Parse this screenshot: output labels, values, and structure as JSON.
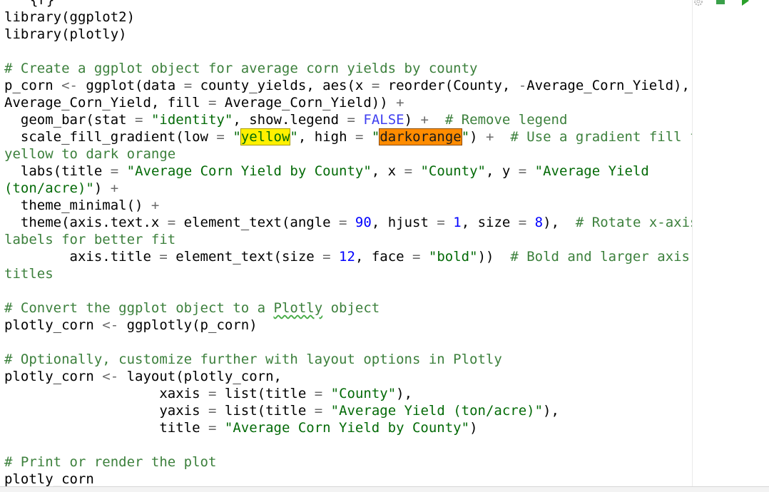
{
  "editor": {
    "lines": {
      "l0": "{r}",
      "l1": "library(ggplot2)",
      "l2": "library(plotly)",
      "l4": "# Create a ggplot object for average corn yields by county",
      "l5": {
        "a": "p_corn ",
        "b": "<-",
        "c": " ggplot(data ",
        "d": "=",
        "e": " county_yields, aes(x ",
        "f": "=",
        "g": " reorder(County, ",
        "h": "-",
        "i": "Average_Corn_Yield), y ",
        "j": "="
      },
      "l6": {
        "a": "Average_Corn_Yield, fill ",
        "b": "=",
        "c": " Average_Corn_Yield)) ",
        "d": "+"
      },
      "l7": {
        "a": "  geom_bar(stat ",
        "b": "=",
        "c": " ",
        "d": "\"identity\"",
        "e": ", show.legend ",
        "f": "=",
        "g": " ",
        "h": "FALSE",
        "i": ") ",
        "j": "+",
        "k": "  ",
        "l": "# Remove legend"
      },
      "l8": {
        "a": "  scale_fill_gradient(low ",
        "b": "=",
        "c": " ",
        "d": "\"",
        "e": "yellow",
        "f": "\"",
        "g": ", high ",
        "h": "=",
        "i": " ",
        "j": "\"",
        "k": "darkorange",
        "l": "\"",
        "m": ") ",
        "n": "+",
        "o": "  ",
        "p": "# Use a gradient fill from"
      },
      "l9": "yellow to dark orange",
      "l10": {
        "a": "  labs(title ",
        "b": "=",
        "c": " ",
        "d": "\"Average Corn Yield by County\"",
        "e": ", x ",
        "f": "=",
        "g": " ",
        "h": "\"County\"",
        "i": ", y ",
        "j": "=",
        "k": " ",
        "l": "\"Average Yield"
      },
      "l11": {
        "a": "(ton/acre)\"",
        "b": ") ",
        "c": "+"
      },
      "l12": {
        "a": "  theme_minimal() ",
        "b": "+"
      },
      "l13": {
        "a": "  theme(axis.text.x ",
        "b": "=",
        "c": " element_text(angle ",
        "d": "=",
        "e": " ",
        "f": "90",
        "g": ", hjust ",
        "h": "=",
        "i": " ",
        "j": "1",
        "k": ", size ",
        "l": "=",
        "m": " ",
        "n": "8",
        "o": "),  ",
        "p": "# Rotate x-axis"
      },
      "l14": "labels for better fit",
      "l15": {
        "a": "        axis.title ",
        "b": "=",
        "c": " element_text(size ",
        "d": "=",
        "e": " ",
        "f": "12",
        "g": ", face ",
        "h": "=",
        "i": " ",
        "j": "\"bold\"",
        "k": "))  ",
        "l": "# Bold and larger axis"
      },
      "l16": "titles",
      "l18": {
        "a": "# Convert the ggplot object to a ",
        "b": "Plotly",
        "c": " object"
      },
      "l19": {
        "a": "plotly_corn ",
        "b": "<-",
        "c": " ggplotly(p_corn)"
      },
      "l21": "# Optionally, customize further with layout options in Plotly",
      "l22": {
        "a": "plotly_corn ",
        "b": "<-",
        "c": " layout(plotly_corn,"
      },
      "l23": {
        "a": "                   xaxis ",
        "b": "=",
        "c": " list(title ",
        "d": "=",
        "e": " ",
        "f": "\"County\"",
        "g": "),"
      },
      "l24": {
        "a": "                   yaxis ",
        "b": "=",
        "c": " list(title ",
        "d": "=",
        "e": " ",
        "f": "\"Average Yield (ton/acre)\"",
        "g": "),"
      },
      "l25": {
        "a": "                   title ",
        "b": "=",
        "c": " ",
        "d": "\"Average Corn Yield by County\"",
        "e": ")"
      },
      "l27": "# Print or render the plot",
      "l28": "plotly_corn"
    }
  },
  "icons": {
    "gear": "gear-icon",
    "collapse": "collapse-chunk-icon",
    "run": "run-chunk-icon"
  },
  "colors": {
    "comment": "#3c803c",
    "string": "#036a07",
    "number": "#0000ff",
    "keyword": "#3e3ef0",
    "highlight_yellow": "#fff000",
    "highlight_orange": "#ff8c00"
  }
}
